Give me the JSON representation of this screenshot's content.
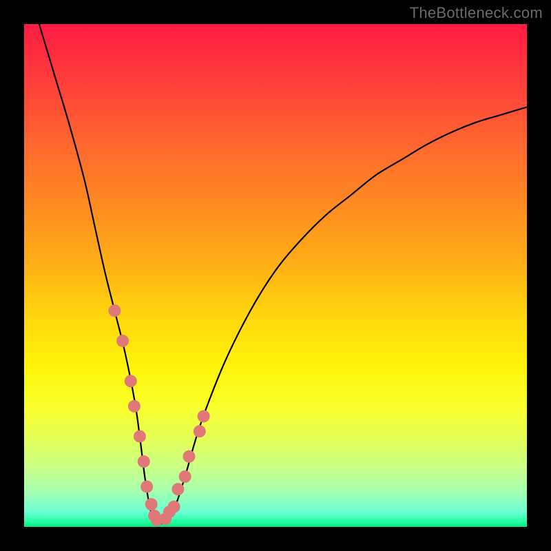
{
  "watermark": "TheBottleneck.com",
  "chart_data": {
    "type": "line",
    "title": "",
    "xlabel": "",
    "ylabel": "",
    "xlim": [
      0,
      100
    ],
    "ylim": [
      0,
      100
    ],
    "curve": {
      "name": "bottleneck",
      "x": [
        3,
        6,
        9,
        12,
        14,
        16,
        18,
        20,
        22,
        23,
        24,
        25,
        26,
        28,
        30,
        32,
        34,
        36,
        40,
        45,
        50,
        55,
        60,
        65,
        70,
        75,
        80,
        85,
        90,
        95,
        100
      ],
      "y": [
        100,
        90,
        80,
        69,
        60,
        51,
        43,
        35,
        25,
        18,
        10,
        4,
        1,
        1,
        4,
        10,
        17,
        23,
        33,
        43,
        51,
        57,
        62,
        66,
        70,
        73,
        76,
        78.5,
        80.5,
        82,
        83.5
      ]
    },
    "scatter": {
      "name": "markers",
      "x": [
        18.0,
        19.6,
        21.2,
        21.9,
        23.0,
        23.8,
        24.4,
        25.3,
        25.9,
        26.4,
        28.1,
        28.9,
        29.8,
        30.6,
        32.0,
        32.8,
        34.9,
        35.7
      ],
      "y": [
        43.0,
        37.0,
        29.0,
        24.0,
        18.0,
        13.0,
        8.0,
        4.5,
        2.2,
        1.4,
        1.6,
        3.0,
        4.0,
        7.5,
        10.0,
        14.0,
        19.0,
        22.0
      ],
      "color": "#e07878",
      "radius": 9
    }
  }
}
